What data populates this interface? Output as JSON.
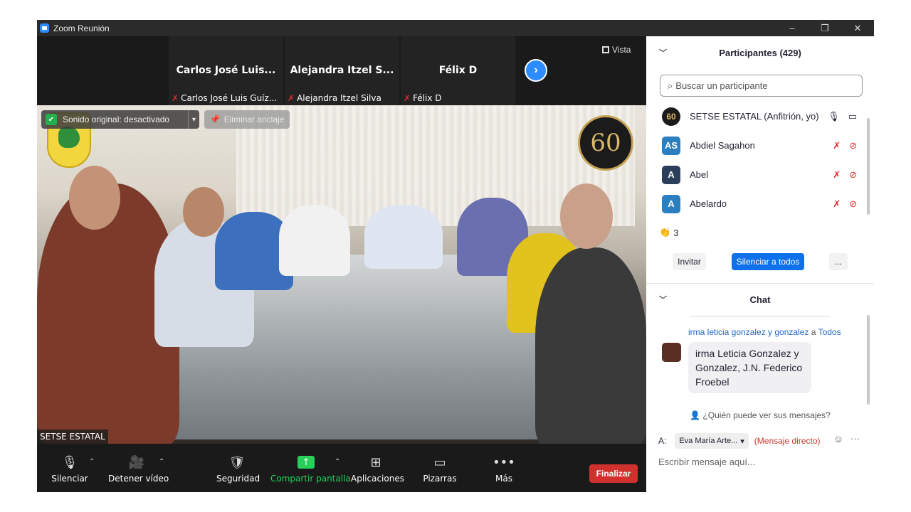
{
  "window": {
    "title": "Zoom Reunión",
    "controls": [
      "–",
      "❐",
      "✕"
    ]
  },
  "strip": {
    "tiles": [
      {
        "display_name": "Carlos José Luis...",
        "label": "Carlos José Luis Guíz..."
      },
      {
        "display_name": "Alejandra  Itzel  S...",
        "label": "Alejandra Itzel Silva"
      },
      {
        "display_name": "Félix D",
        "label": "Félix D"
      }
    ],
    "view_label": "Vista"
  },
  "main_video": {
    "audio_status": "Sonido original: desactivado",
    "unpin_label": "Eliminar anclaje",
    "speaker_name": "SETSE ESTATAL",
    "logo_text": "60"
  },
  "toolbar": {
    "mute": "Silenciar",
    "stop_video": "Detener vídeo",
    "security": "Seguridad",
    "share": "Compartir pantalla",
    "apps": "Aplicaciones",
    "whiteboards": "Pizarras",
    "more": "Más",
    "end": "Finalizar"
  },
  "participants": {
    "title": "Participantes (429)",
    "search_placeholder": "Buscar un participante",
    "list": [
      {
        "initials": "60",
        "name": "SETSE ESTATAL (Anfitrión, yo)",
        "color": "#1b1b1b"
      },
      {
        "initials": "AS",
        "name": "Abdiel Sagahon",
        "color": "#2a7fc1"
      },
      {
        "initials": "A",
        "name": "Abel",
        "color": "#2b3f5c"
      },
      {
        "initials": "A",
        "name": "Abelardo",
        "color": "#2a7fc1"
      }
    ],
    "reaction_count": "3",
    "invite": "Invitar",
    "mute_all": "Silenciar a todos",
    "more": "..."
  },
  "chat": {
    "title": "Chat",
    "sender": "irma leticia gonzalez y gonzalez",
    "to_word": "a",
    "recipient": "Todos",
    "message": "irma Leticia Gonzalez y Gonzalez, J.N. Federico Froebel",
    "who_can_see": "¿Quién puede ver sus mensajes?",
    "to_label": "A:",
    "to_selected": "Eva María Arte...",
    "direct_label": "(Mensaje directo)",
    "composer_placeholder": "Escribir mensaje aquí..."
  }
}
